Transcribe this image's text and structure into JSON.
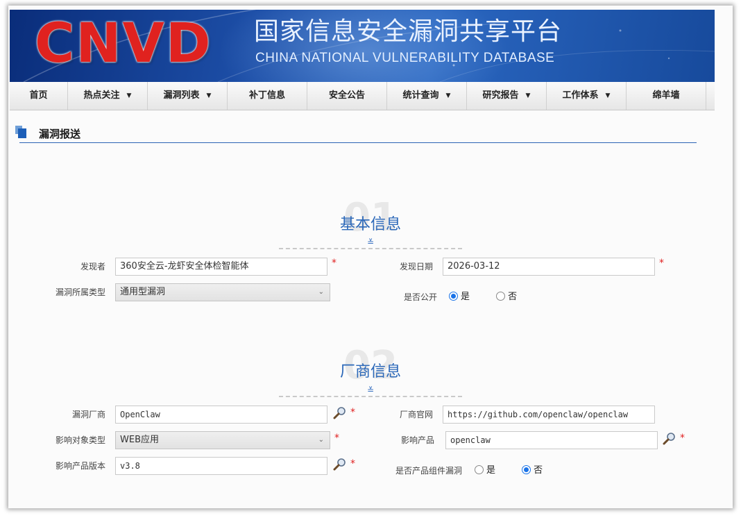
{
  "banner": {
    "logo": "CNVD",
    "title_cn": "国家信息安全漏洞共享平台",
    "title_en": "CHINA NATIONAL VULNERABILITY DATABASE"
  },
  "nav": {
    "items": [
      {
        "label": "首页",
        "dropdown": false
      },
      {
        "label": "热点关注",
        "dropdown": true
      },
      {
        "label": "漏洞列表",
        "dropdown": true
      },
      {
        "label": "补丁信息",
        "dropdown": false
      },
      {
        "label": "安全公告",
        "dropdown": false
      },
      {
        "label": "统计查询",
        "dropdown": true
      },
      {
        "label": "研究报告",
        "dropdown": true
      },
      {
        "label": "工作体系",
        "dropdown": true
      },
      {
        "label": "绵羊墙",
        "dropdown": false
      }
    ],
    "caret": "▼"
  },
  "section": {
    "title": "漏洞报送"
  },
  "basic": {
    "number": "01",
    "title": "基本信息",
    "chevron": "≚",
    "discoverer_label": "发现者",
    "discoverer_value": "360安全云-龙虾安全体检智能体",
    "date_label": "发现日期",
    "date_value": "2026-03-12",
    "type_label": "漏洞所属类型",
    "type_value": "通用型漏洞",
    "public_label": "是否公开",
    "public_yes": "是",
    "public_no": "否",
    "public_selected": "是"
  },
  "vendor": {
    "number": "02",
    "title": "厂商信息",
    "chevron": "≚",
    "vendor_label": "漏洞厂商",
    "vendor_value": "OpenClaw",
    "site_label": "厂商官网",
    "site_value": "https://github.com/openclaw/openclaw",
    "objtype_label": "影响对象类型",
    "objtype_value": "WEB应用",
    "product_label": "影响产品",
    "product_value": "openclaw",
    "version_label": "影响产品版本",
    "version_value": "v3.8",
    "component_label": "是否产品组件漏洞",
    "component_yes": "是",
    "component_no": "否",
    "component_selected": "否"
  },
  "required_mark": "*",
  "select_arrow": "⌄",
  "colors": {
    "accent": "#2a67b8",
    "required": "#e01f1f",
    "logo": "#e0221f",
    "radio": "#1a73e8"
  },
  "icons": {
    "search": "magnifier-icon",
    "section": "section-square-icon"
  }
}
